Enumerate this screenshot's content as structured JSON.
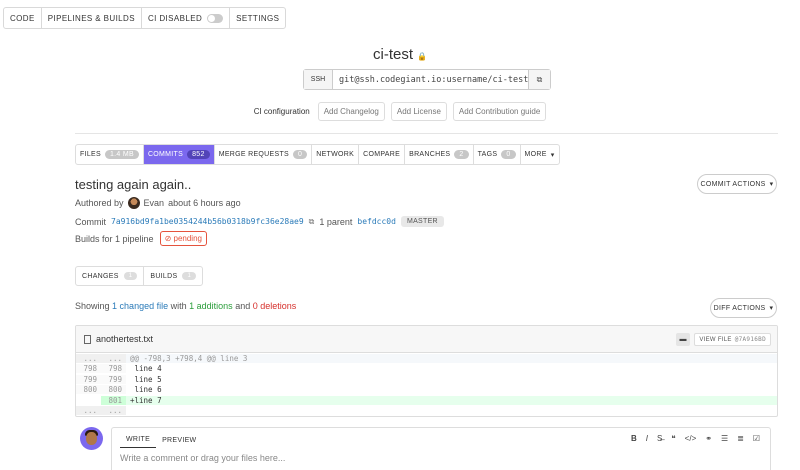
{
  "topnav": {
    "code": "CODE",
    "pipelines": "PIPELINES & BUILDS",
    "ci": "CI DISABLED",
    "settings": "SETTINGS"
  },
  "repo": {
    "name": "ci-test",
    "clone_protocol": "SSH",
    "clone_url": "git@ssh.codegiant.io:username/ci-test.g"
  },
  "setup": {
    "ci_config": "CI configuration",
    "changelog": "Add Changelog",
    "license": "Add License",
    "contrib": "Add Contribution guide"
  },
  "tabs": [
    {
      "label": "FILES",
      "count": "1.4 MB"
    },
    {
      "label": "COMMITS",
      "count": "852"
    },
    {
      "label": "MERGE REQUESTS",
      "count": "0"
    },
    {
      "label": "NETWORK"
    },
    {
      "label": "COMPARE"
    },
    {
      "label": "BRANCHES",
      "count": "2"
    },
    {
      "label": "TAGS",
      "count": "0"
    },
    {
      "label": "MORE"
    }
  ],
  "commit": {
    "title": "testing again again..",
    "actions_label": "COMMIT ACTIONS",
    "authored_by": "Authored by",
    "author": "Evan",
    "time": "about 6 hours ago",
    "commit_label": "Commit",
    "sha": "7a916bd9fa1be0354244b56b0318b9fc36e28ae9",
    "parent_label": "1 parent",
    "parent_sha": "befdcc0d",
    "branch": "MASTER",
    "builds_text": "Builds for 1 pipeline",
    "status": "pending"
  },
  "subtabs": [
    {
      "label": "CHANGES",
      "count": "1"
    },
    {
      "label": "BUILDS",
      "count": "1"
    }
  ],
  "summary": {
    "showing": "Showing",
    "files_changed": "1 changed file",
    "with": "with",
    "additions": "1 additions",
    "and": "and",
    "deletions": "0 deletions",
    "diff_actions": "DIFF ACTIONS"
  },
  "file": {
    "name": "anothertest.txt",
    "view_file": "VIEW FILE",
    "ref": "@7A916BD"
  },
  "diff_lines": [
    {
      "type": "hunk",
      "old": "...",
      "new": "...",
      "text": "@@ -798,3 +798,4 @@ line 3"
    },
    {
      "type": "ctx",
      "old": "798",
      "new": "798",
      "text": " line 4"
    },
    {
      "type": "ctx",
      "old": "799",
      "new": "799",
      "text": " line 5"
    },
    {
      "type": "ctx",
      "old": "800",
      "new": "800",
      "text": " line 6"
    },
    {
      "type": "added",
      "old": "",
      "new": "801",
      "text": "+line 7"
    },
    {
      "type": "hunk",
      "old": "...",
      "new": "...",
      "text": ""
    }
  ],
  "editor": {
    "tab_write": "WRITE",
    "tab_preview": "PREVIEW",
    "placeholder": "Write a comment or drag your files here..."
  },
  "colors": {
    "accent": "#7b68ee",
    "link": "#2b7bb9",
    "addition": "#2a9d3a",
    "deletion": "#d6302c",
    "pending": "#e5533d"
  }
}
